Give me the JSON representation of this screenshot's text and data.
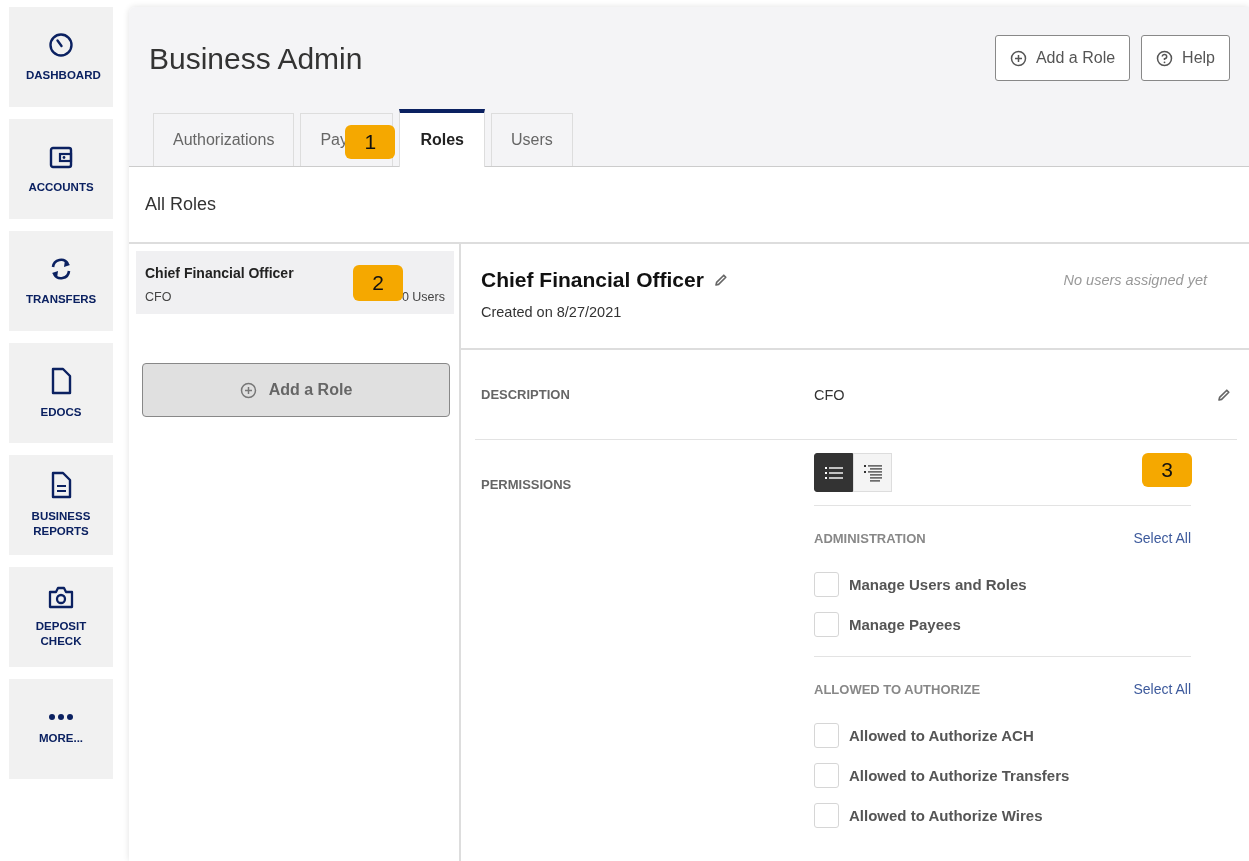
{
  "nav": [
    {
      "label": "DASHBOARD",
      "kind": "gauge"
    },
    {
      "label": "ACCOUNTS",
      "kind": "wallet"
    },
    {
      "label": "TRANSFERS",
      "kind": "transfer"
    },
    {
      "label": "EDOCS",
      "kind": "file"
    },
    {
      "label": "BUSINESS REPORTS",
      "kind": "report"
    },
    {
      "label": "DEPOSIT CHECK",
      "kind": "camera"
    },
    {
      "label": "MORE...",
      "kind": "more"
    }
  ],
  "page": {
    "title": "Business Admin",
    "actions": [
      {
        "label": "Add a Role",
        "kind": "add"
      },
      {
        "label": "Help",
        "kind": "help"
      }
    ]
  },
  "tabs": [
    {
      "label": "Authorizations",
      "selected": false
    },
    {
      "label": "Pay",
      "selected": false
    },
    {
      "label": "Roles",
      "selected": true
    },
    {
      "label": "Users",
      "selected": false
    }
  ],
  "section_title": "All Roles",
  "roles": [
    {
      "name": "Chief Financial Officer",
      "abbreviation": "CFO",
      "users": "0 Users",
      "selected": true
    }
  ],
  "add_role_button": "Add a Role",
  "detail": {
    "title": "Chief Financial Officer",
    "created": "Created on 8/27/2021",
    "assignment": "No users assigned yet",
    "description_label": "DESCRIPTION",
    "description": "CFO",
    "permissions_label": "PERMISSIONS",
    "view_toggle": [
      {
        "kind": "list",
        "selected": true
      },
      {
        "kind": "indented",
        "selected": false
      }
    ],
    "groups": [
      {
        "title": "ADMINISTRATION",
        "select_all": "Select All",
        "items": [
          {
            "label": "Manage Users and Roles",
            "checked": false
          },
          {
            "label": "Manage Payees",
            "checked": false
          }
        ]
      },
      {
        "title": "ALLOWED TO AUTHORIZE",
        "select_all": "Select All",
        "items": [
          {
            "label": "Allowed to Authorize ACH",
            "checked": false
          },
          {
            "label": "Allowed to Authorize Transfers",
            "checked": false
          },
          {
            "label": "Allowed to Authorize Wires",
            "checked": false
          }
        ]
      }
    ]
  },
  "annotations": [
    {
      "label": "1"
    },
    {
      "label": "2"
    },
    {
      "label": "3"
    }
  ]
}
